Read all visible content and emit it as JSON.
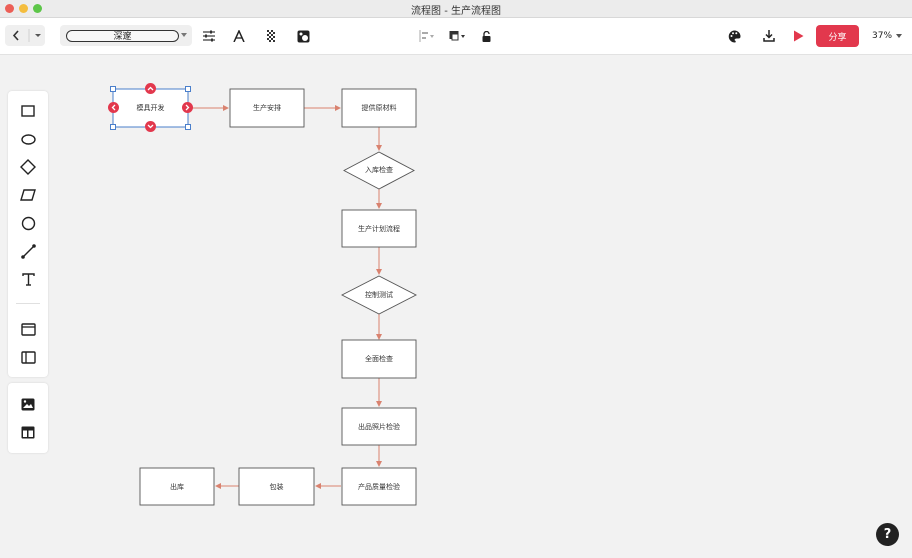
{
  "window": {
    "title": "流程图 - 生产流程图"
  },
  "toolbar": {
    "theme_label": "深邃",
    "zoom_label": "37%",
    "share_label": "分享",
    "icons": [
      "back-icon",
      "dropdown-icon",
      "settings-sliders-icon",
      "text-format-icon",
      "pattern-icon",
      "fill-icon",
      "align-icon",
      "arrange-icon",
      "lock-icon",
      "palette-icon",
      "download-icon",
      "play-icon"
    ]
  },
  "tools": {
    "shapes": [
      "rectangle",
      "ellipse",
      "diamond",
      "parallelogram",
      "circle",
      "connector",
      "text"
    ],
    "containers": [
      "frame",
      "sidebar-frame"
    ],
    "media": [
      "image",
      "template"
    ]
  },
  "flowchart": {
    "nodes": [
      {
        "id": "n1",
        "label": "模具开发",
        "shape": "rect",
        "selected": true
      },
      {
        "id": "n2",
        "label": "生产安排",
        "shape": "rect"
      },
      {
        "id": "n3",
        "label": "提供原材料",
        "shape": "rect"
      },
      {
        "id": "n4",
        "label": "入库检查",
        "shape": "diamond"
      },
      {
        "id": "n5",
        "label": "生产计划流程",
        "shape": "rect"
      },
      {
        "id": "n6",
        "label": "控制测试",
        "shape": "diamond"
      },
      {
        "id": "n7",
        "label": "全面检查",
        "shape": "rect"
      },
      {
        "id": "n8",
        "label": "出品照片检验",
        "shape": "rect"
      },
      {
        "id": "n9",
        "label": "产品质量检验",
        "shape": "rect"
      },
      {
        "id": "n10",
        "label": "包装",
        "shape": "rect"
      },
      {
        "id": "n11",
        "label": "出库",
        "shape": "rect"
      }
    ]
  },
  "help": {
    "label": "?"
  },
  "colors": {
    "accent": "#e2384d",
    "selection": "#4a7fcb",
    "edge": "#d9826f",
    "node_border": "#555555"
  }
}
